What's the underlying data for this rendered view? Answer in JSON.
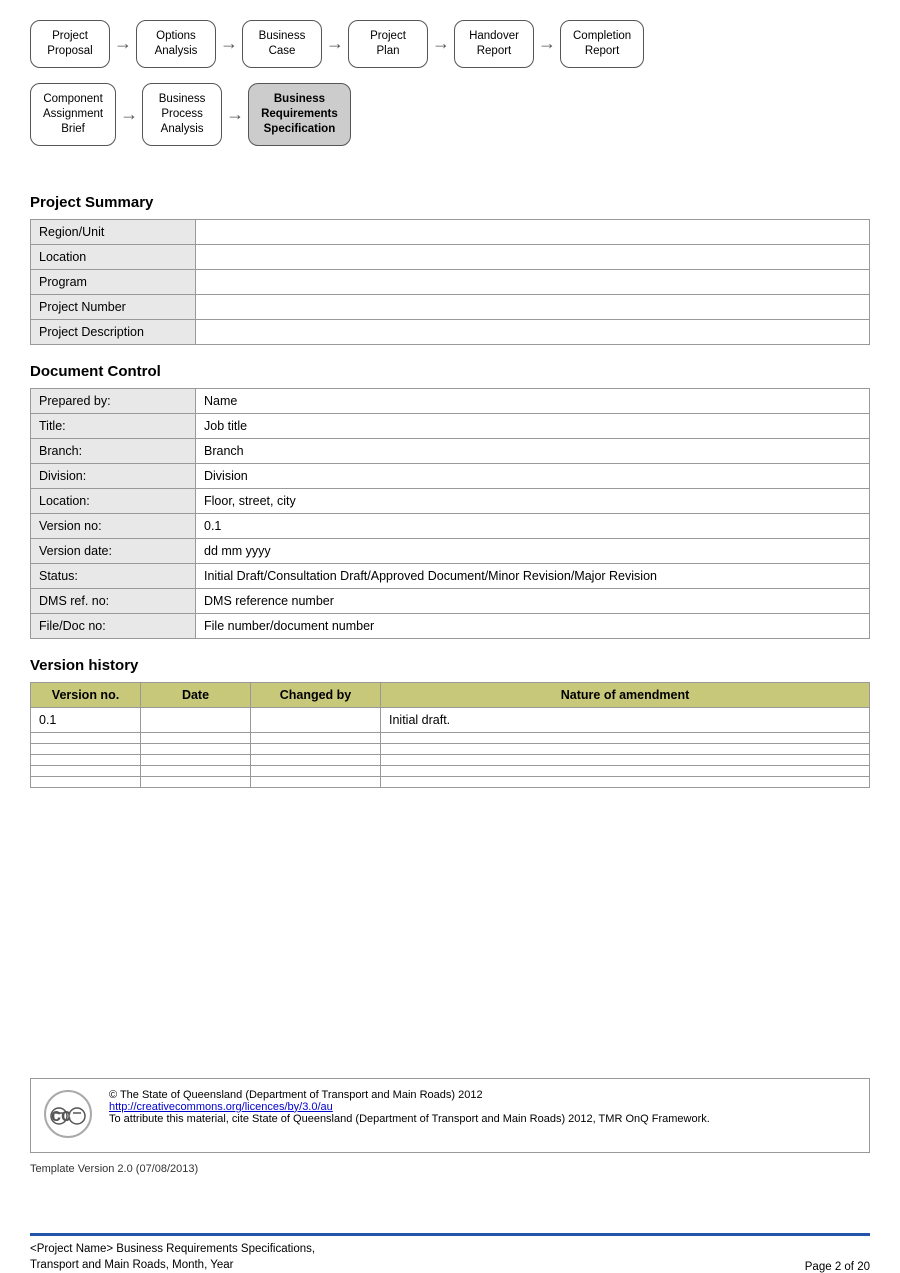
{
  "flow1": {
    "items": [
      {
        "label": "Project\nProposal",
        "highlighted": false
      },
      {
        "label": "Options\nAnalysis",
        "highlighted": false
      },
      {
        "label": "Business\nCase",
        "highlighted": false
      },
      {
        "label": "Project\nPlan",
        "highlighted": false
      },
      {
        "label": "Handover\nReport",
        "highlighted": false
      },
      {
        "label": "Completion\nReport",
        "highlighted": false
      }
    ]
  },
  "flow2": {
    "items": [
      {
        "label": "Component\nAssignment\nBrief",
        "highlighted": false
      },
      {
        "label": "Business\nProcess\nAnalysis",
        "highlighted": false
      },
      {
        "label": "Business\nRequirements\nSpecification",
        "highlighted": true
      }
    ]
  },
  "project_summary": {
    "title": "Project Summary",
    "rows": [
      {
        "label": "Region/Unit",
        "value": ""
      },
      {
        "label": "Location",
        "value": ""
      },
      {
        "label": "Program",
        "value": ""
      },
      {
        "label": "Project Number",
        "value": ""
      },
      {
        "label": "Project Description",
        "value": ""
      }
    ]
  },
  "document_control": {
    "title": "Document Control",
    "rows": [
      {
        "label": "Prepared by:",
        "value": "Name"
      },
      {
        "label": "Title:",
        "value": "Job title"
      },
      {
        "label": "Branch:",
        "value": "Branch"
      },
      {
        "label": "Division:",
        "value": "Division"
      },
      {
        "label": "Location:",
        "value": "Floor, street, city"
      },
      {
        "label": "Version no:",
        "value": "0.1"
      },
      {
        "label": "Version date:",
        "value": "dd mm yyyy"
      },
      {
        "label": "Status:",
        "value": "Initial Draft/Consultation Draft/Approved Document/Minor Revision/Major Revision"
      },
      {
        "label": "DMS ref. no:",
        "value": "DMS reference number"
      },
      {
        "label": "File/Doc no:",
        "value": "File number/document number"
      }
    ]
  },
  "version_history": {
    "title": "Version history",
    "headers": [
      "Version no.",
      "Date",
      "Changed by",
      "Nature of amendment"
    ],
    "rows": [
      {
        "version": "0.1",
        "date": "",
        "changed_by": "",
        "nature": "Initial draft."
      },
      {
        "version": "",
        "date": "",
        "changed_by": "",
        "nature": ""
      },
      {
        "version": "",
        "date": "",
        "changed_by": "",
        "nature": ""
      },
      {
        "version": "",
        "date": "",
        "changed_by": "",
        "nature": ""
      },
      {
        "version": "",
        "date": "",
        "changed_by": "",
        "nature": ""
      },
      {
        "version": "",
        "date": "",
        "changed_by": "",
        "nature": ""
      }
    ]
  },
  "footer": {
    "copyright": "© The State of Queensland (Department of Transport and Main Roads) 2012",
    "cc_link_text": "http://creativecommons.org/licences/by/3.0/au",
    "cc_link_url": "http://creativecommons.org/licences/by/3.0/au",
    "attribution": "To attribute this material, cite State of Queensland (Department of Transport and Main Roads) 2012, TMR OnQ Framework.",
    "template_version": "Template Version 2.0 (07/08/2013)"
  },
  "bottom": {
    "left_line1": "<Project Name> Business Requirements Specifications,",
    "left_line2": "Transport and Main Roads, Month, Year",
    "right": "Page 2 of 20"
  }
}
